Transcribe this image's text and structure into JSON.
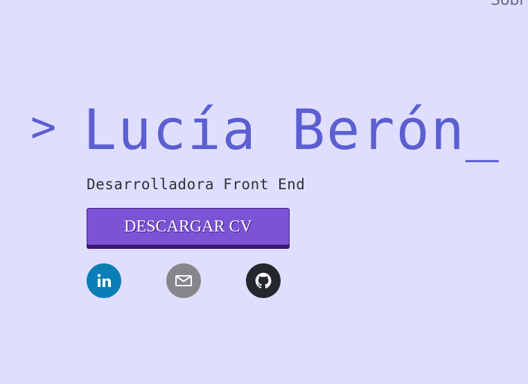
{
  "nav": {
    "link_label": "Sobr"
  },
  "hero": {
    "prompt": ">",
    "name": "Lucía Berón_",
    "subtitle": "Desarrolladora Front End",
    "cv_button": "DESCARGAR CV"
  },
  "social": [
    {
      "name": "linkedin",
      "icon": "linkedin-icon",
      "color": "#0a7fb5"
    },
    {
      "name": "email",
      "icon": "mail-icon",
      "color": "#86868b"
    },
    {
      "name": "github",
      "icon": "github-icon",
      "color": "#24272c"
    }
  ],
  "colors": {
    "background": "#e0defe",
    "accent": "#5b5fd1",
    "button": "#7a54d4"
  }
}
